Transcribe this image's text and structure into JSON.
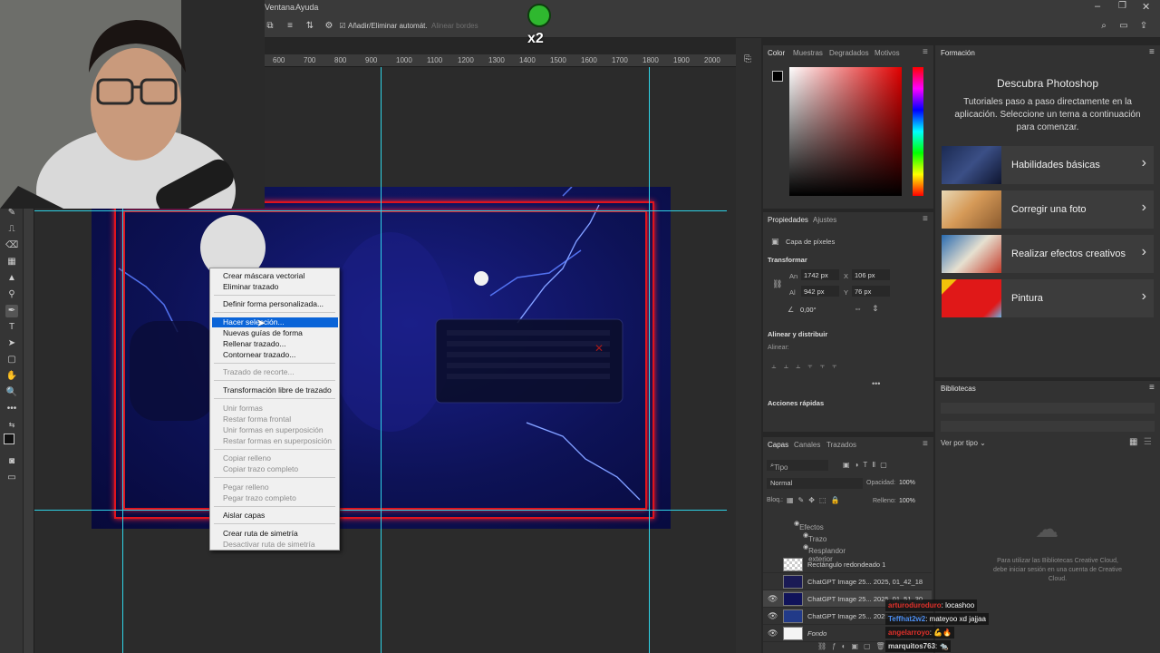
{
  "menubar": {
    "items": [
      "Ventana",
      "Ayuda"
    ]
  },
  "options_bar": {
    "auto_add_delete_label": "Añadir/Eliminar automát.",
    "align_edges_label": "Alinear bordes"
  },
  "overlay_badge": {
    "text": "x2"
  },
  "ruler": {
    "ticks": [
      "600",
      "700",
      "800",
      "900",
      "1000",
      "1100",
      "1200",
      "1300",
      "1400",
      "1500",
      "1600",
      "1700",
      "1800",
      "1900",
      "2000"
    ]
  },
  "context_menu": {
    "items": [
      {
        "label": "Crear máscara vectorial",
        "disabled": false
      },
      {
        "label": "Eliminar trazado",
        "disabled": false
      },
      {
        "label": "Definir forma personalizada...",
        "disabled": false
      },
      {
        "label": "Hacer selección...",
        "disabled": false,
        "highlighted": true
      },
      {
        "label": "Nuevas guías de forma",
        "disabled": false
      },
      {
        "label": "Rellenar trazado...",
        "disabled": false
      },
      {
        "label": "Contornear trazado...",
        "disabled": false
      },
      {
        "label": "Trazado de recorte...",
        "disabled": true
      },
      {
        "label": "Transformación libre de trazado",
        "disabled": false
      },
      {
        "label": "Unir formas",
        "disabled": true
      },
      {
        "label": "Restar forma frontal",
        "disabled": true
      },
      {
        "label": "Unir formas en superposición",
        "disabled": true
      },
      {
        "label": "Restar formas en superposición",
        "disabled": true
      },
      {
        "label": "Copiar relleno",
        "disabled": true
      },
      {
        "label": "Copiar trazo completo",
        "disabled": true
      },
      {
        "label": "Pegar relleno",
        "disabled": true
      },
      {
        "label": "Pegar trazo completo",
        "disabled": true
      },
      {
        "label": "Aislar capas",
        "disabled": false
      },
      {
        "label": "Crear ruta de simetría",
        "disabled": false
      },
      {
        "label": "Desactivar ruta de simetría",
        "disabled": true
      }
    ]
  },
  "color_panel": {
    "tabs": [
      "Color",
      "Muestras",
      "Degradados",
      "Motivos"
    ]
  },
  "properties_panel": {
    "tabs": [
      "Propiedades",
      "Ajustes"
    ],
    "layer_type": "Capa de píxeles",
    "transform_title": "Transformar",
    "width_label": "An",
    "width_value": "1742 px",
    "height_label": "Al",
    "height_value": "942 px",
    "x_label": "X",
    "x_value": "106 px",
    "y_label": "Y",
    "y_value": "76 px",
    "angle_value": "0,00°",
    "align_title": "Alinear y distribuir",
    "align_sub": "Alinear:",
    "quick_actions_title": "Acciones rápidas",
    "more": "•••"
  },
  "layers_panel": {
    "tabs": [
      "Capas",
      "Canales",
      "Trazados"
    ],
    "filter_label": "Tipo",
    "blend_mode": "Normal",
    "opacity_label": "Opacidad:",
    "opacity_value": "100%",
    "lock_label": "Bloq.:",
    "fill_label": "Relleno:",
    "fill_value": "100%",
    "effects_label": "Efectos",
    "effect_items": [
      "Trazo",
      "Resplandor exterior"
    ],
    "layers": [
      {
        "name": "Rectángulo redondeado 1",
        "visible": false
      },
      {
        "name": "ChatGPT Image 25... 2025, 01_42_18",
        "visible": false
      },
      {
        "name": "ChatGPT Image 25... 2025, 01_51_30",
        "visible": true
      },
      {
        "name": "ChatGPT Image 25... 2025, 01_54_28",
        "visible": true
      },
      {
        "name": "Fondo",
        "visible": true
      }
    ]
  },
  "learn_panel": {
    "tab": "Formación",
    "title": "Descubra Photoshop",
    "description": "Tutoriales paso a paso directamente en la aplicación. Seleccione un tema a continuación para comenzar.",
    "cards": [
      "Habilidades básicas",
      "Corregir una foto",
      "Realizar efectos creativos",
      "Pintura"
    ]
  },
  "libraries_panel": {
    "tab": "Bibliotecas",
    "view_label": "Ver por tipo",
    "message": "Para utilizar las Bibliotecas Creative Cloud, debe iniciar sesión en una cuenta de Creative Cloud."
  },
  "chat": [
    {
      "user": "arturoduroduro",
      "message": ": locashoo",
      "color": "#e0302a"
    },
    {
      "user": "Teffhat2w2",
      "message": ": mateyoo xd jajjaa",
      "color": "#4b8df0"
    },
    {
      "user": "angelarroyo",
      "message": ": 💪🔥",
      "color": "#e0302a"
    },
    {
      "user": "marquitos763",
      "message": ": 🐀",
      "color": "#d8d8d8"
    }
  ]
}
